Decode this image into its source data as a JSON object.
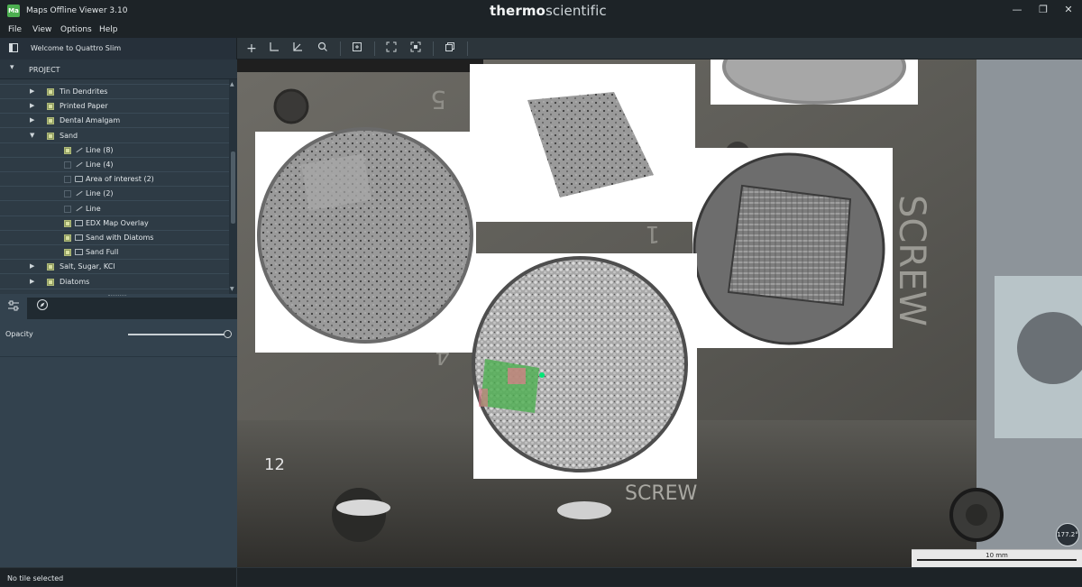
{
  "app": {
    "logo_text": "Ma",
    "title": "Maps Offline Viewer 3.10",
    "brand_bold": "thermo",
    "brand_light": "scientific"
  },
  "window_controls": {
    "minimize": "—",
    "restore": "❐",
    "close": "✕"
  },
  "menu": {
    "items": [
      "File",
      "View",
      "Options",
      "Help"
    ]
  },
  "toolbar": {
    "welcome": "Welcome to Quattro Slim",
    "tools": [
      "add-icon",
      "measure-line-icon",
      "measure-angle-icon",
      "zoom-icon",
      "fit-icon",
      "fullscreen-icon",
      "frame-icon",
      "window-icon"
    ]
  },
  "project": {
    "header": "PROJECT",
    "items": [
      {
        "label": "Tin Dendrites",
        "checked": true,
        "expanded": false,
        "level": 1,
        "icon": "none"
      },
      {
        "label": "Printed Paper",
        "checked": true,
        "expanded": false,
        "level": 1,
        "icon": "none"
      },
      {
        "label": "Dental Amalgam",
        "checked": true,
        "expanded": false,
        "level": 1,
        "icon": "none"
      },
      {
        "label": "Sand",
        "checked": true,
        "expanded": true,
        "level": 1,
        "icon": "none"
      },
      {
        "label": "Line (8)",
        "checked": true,
        "expanded": null,
        "level": 2,
        "icon": "line"
      },
      {
        "label": "Line (4)",
        "checked": false,
        "expanded": null,
        "level": 2,
        "icon": "line"
      },
      {
        "label": "Area of interest (2)",
        "checked": false,
        "expanded": null,
        "level": 2,
        "icon": "note"
      },
      {
        "label": "Line (2)",
        "checked": false,
        "expanded": null,
        "level": 2,
        "icon": "line"
      },
      {
        "label": "Line",
        "checked": false,
        "expanded": null,
        "level": 2,
        "icon": "line"
      },
      {
        "label": "EDX Map Overlay",
        "checked": true,
        "expanded": null,
        "level": 2,
        "icon": "tile"
      },
      {
        "label": "Sand with Diatoms",
        "checked": true,
        "expanded": null,
        "level": 2,
        "icon": "tile"
      },
      {
        "label": "Sand Full",
        "checked": true,
        "expanded": null,
        "level": 2,
        "icon": "tile"
      },
      {
        "label": "Salt, Sugar, KCl",
        "checked": true,
        "expanded": false,
        "level": 1,
        "icon": "none"
      },
      {
        "label": "Diatoms",
        "checked": true,
        "expanded": false,
        "level": 1,
        "icon": "none"
      }
    ]
  },
  "properties": {
    "opacity_label": "Opacity",
    "opacity_value": 1.0
  },
  "viewport": {
    "scale_label": "10 mm",
    "rotation": "177.2°",
    "stage_text_screw": "SCREW",
    "stage_text_num": "5",
    "stage_text_one": "1",
    "stage_text_four": "4",
    "stage_text_bottom": "SCREW",
    "stage_text_12": "12"
  },
  "status": {
    "text": "No tile selected"
  }
}
